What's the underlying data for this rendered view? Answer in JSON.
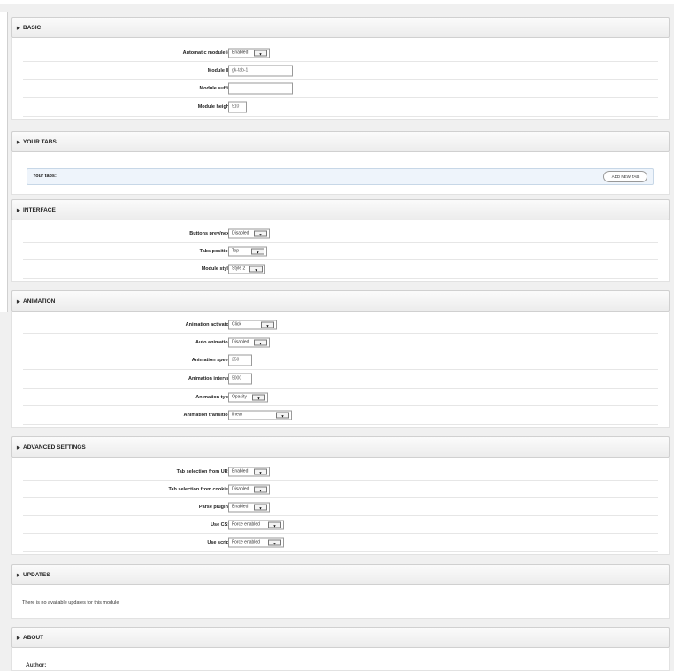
{
  "sections": {
    "basic": {
      "title": "BASIC",
      "rows": [
        {
          "label": "Automatic module id",
          "value": "Enabled"
        },
        {
          "label": "Module ID",
          "value": "gk-tab-1"
        },
        {
          "label": "Module suffix",
          "value": ""
        },
        {
          "label": "Module height",
          "value": "510"
        }
      ]
    },
    "your_tabs": {
      "title": "YOUR TABS",
      "panel_label": "Your tabs:",
      "add_button": "ADD NEW TAB"
    },
    "interface": {
      "title": "INTERFACE",
      "rows": [
        {
          "label": "Buttons prev/next",
          "value": "Disabled"
        },
        {
          "label": "Tabs position",
          "value": "Top"
        },
        {
          "label": "Module style",
          "value": "Style 2"
        }
      ]
    },
    "animation": {
      "title": "ANIMATION",
      "rows": [
        {
          "label": "Animation activator",
          "value": "Click"
        },
        {
          "label": "Auto animation",
          "value": "Disabled"
        },
        {
          "label": "Animation speed",
          "value": "250"
        },
        {
          "label": "Animation interval",
          "value": "5000"
        },
        {
          "label": "Animation type",
          "value": "Opacity"
        },
        {
          "label": "Animation transition",
          "value": "linear"
        }
      ]
    },
    "advanced": {
      "title": "ADVANCED SETTINGS",
      "rows": [
        {
          "label": "Tab selection from URL",
          "value": "Enabled"
        },
        {
          "label": "Tab selection from cookies",
          "value": "Disabled"
        },
        {
          "label": "Parse plugins",
          "value": "Enabled"
        },
        {
          "label": "Use CSS",
          "value": "Force enabled"
        },
        {
          "label": "Use script",
          "value": "Force enabled"
        }
      ]
    },
    "updates": {
      "title": "UPDATES",
      "note": "There is no available updates for this module"
    },
    "about": {
      "title": "ABOUT",
      "author_label": "Author:"
    }
  },
  "icons": {
    "section_arrow": "triangle-right-icon",
    "dropdown": "chevron-down-icon"
  }
}
